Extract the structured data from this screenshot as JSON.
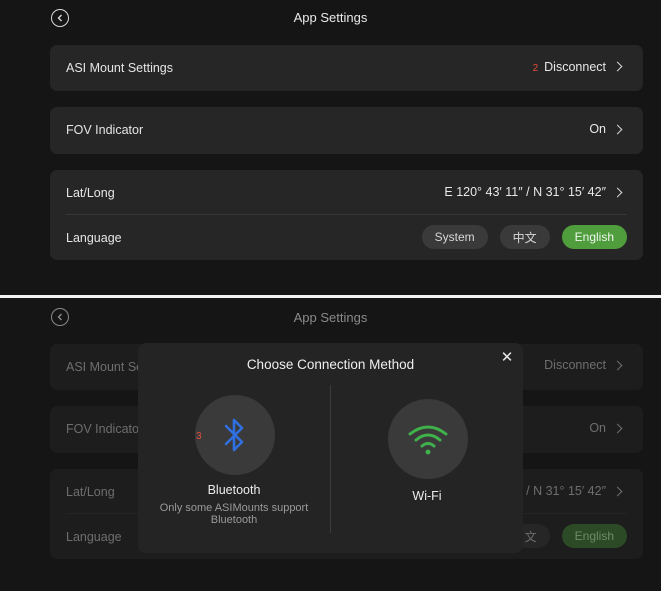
{
  "screen1": {
    "title": "App Settings",
    "rows": {
      "mount": {
        "label": "ASI Mount Settings",
        "badge": "2",
        "value": "Disconnect"
      },
      "fov": {
        "label": "FOV Indicator",
        "value": "On"
      },
      "latlong": {
        "label": "Lat/Long",
        "value": "E 120° 43′ 11″ / N 31° 15′ 42″"
      },
      "language": {
        "label": "Language",
        "options": [
          "System",
          "中文",
          "English"
        ],
        "selected": "English"
      }
    }
  },
  "screen2": {
    "title": "App Settings",
    "bg": {
      "mount_label": "ASI Mount Se",
      "mount_value": "Disconnect",
      "fov_label": "FOV Indicato",
      "fov_value": "On",
      "latlong_label": "Lat/Long",
      "latlong_value": "′ / N 31° 15′ 42″",
      "language_label": "Language",
      "lang_partial": "文",
      "lang_selected": "English"
    },
    "modal": {
      "title": "Choose Connection Method",
      "close": "✕",
      "bluetooth": {
        "badge": "3",
        "label": "Bluetooth",
        "sub_line1": "Only some ASIMounts support",
        "sub_line2": "Bluetooth"
      },
      "wifi": {
        "label": "Wi-Fi"
      }
    }
  },
  "colors": {
    "accent_green": "#4f9d3c",
    "bluetooth_blue": "#2f6fe0",
    "wifi_green": "#3fb24b",
    "badge_red": "#e34b3a"
  },
  "icons": [
    "back-icon",
    "chevron-right-icon",
    "close-icon",
    "bluetooth-icon",
    "wifi-icon"
  ]
}
